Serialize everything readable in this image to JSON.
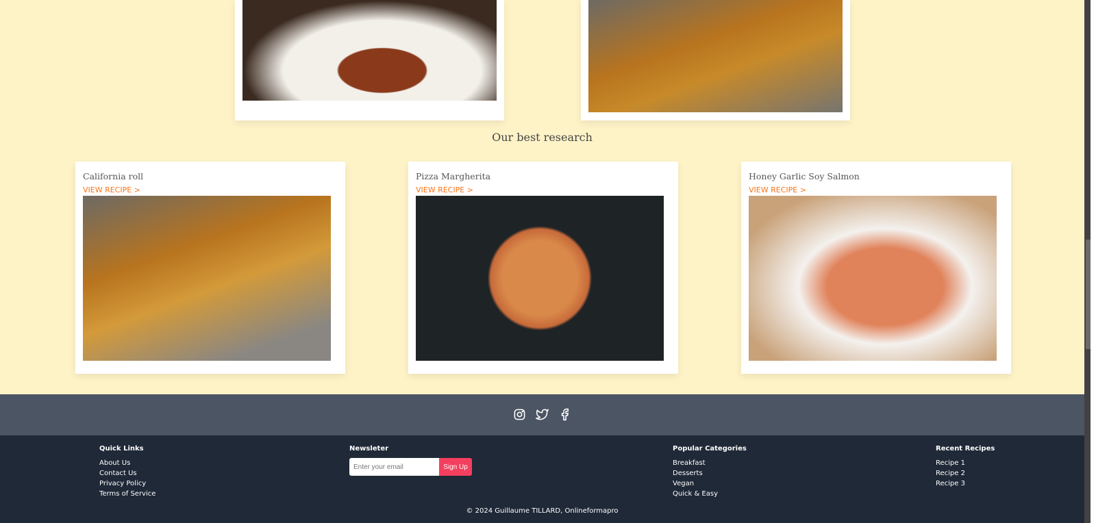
{
  "section_title": "Our best research",
  "recipes": [
    {
      "name": "California roll",
      "link": "VIEW RECIPE >"
    },
    {
      "name": "Pizza Margherita",
      "link": "VIEW RECIPE >"
    },
    {
      "name": "Honey Garlic Soy Salmon",
      "link": "VIEW RECIPE >"
    }
  ],
  "social": [
    "instagram-icon",
    "twitter-icon",
    "facebook-icon"
  ],
  "footer": {
    "quick_links": {
      "title": "Quick Links",
      "items": [
        "About Us",
        "Contact Us",
        "Privacy Policy",
        "Terms of Service"
      ]
    },
    "newsletter": {
      "title": "Newsleter",
      "placeholder": "Enter your email",
      "button": "Sign Up"
    },
    "categories": {
      "title": "Popular Categories",
      "items": [
        "Breakfast",
        "Desserts",
        "Vegan",
        "Quick & Easy"
      ]
    },
    "recent": {
      "title": "Recent Recipes",
      "items": [
        "Recipe 1",
        "Recipe 2",
        "Recipe 3"
      ]
    },
    "copyright": "© 2024 Guillaume TILLARD, Onlineformapro"
  },
  "colors": {
    "background": "#fef3c7",
    "accent": "#f97316",
    "button": "#f43f5e",
    "footer": "#1f2937"
  }
}
